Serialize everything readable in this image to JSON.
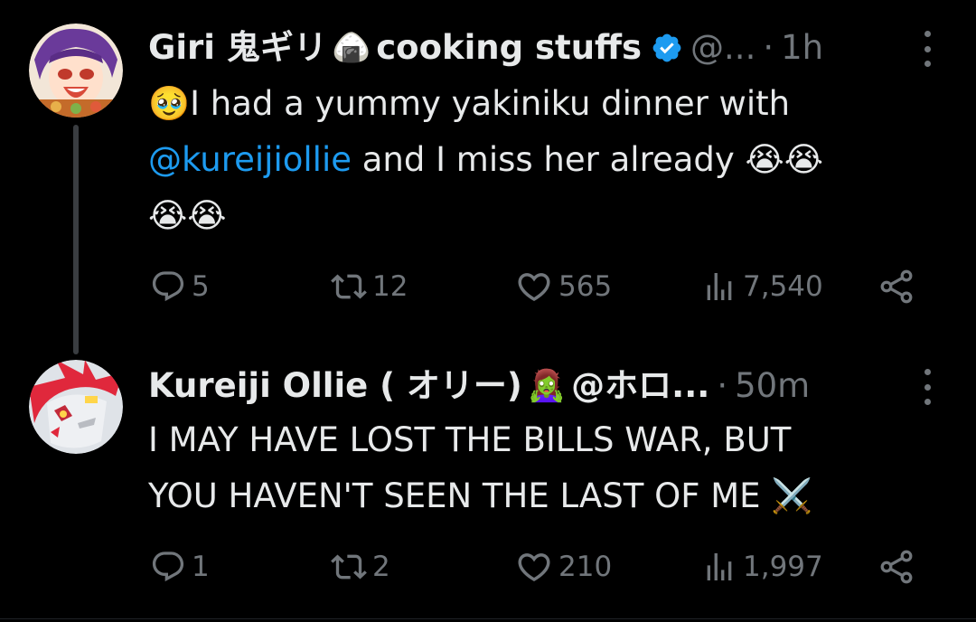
{
  "colors": {
    "background": "#000000",
    "text": "#e7e9ea",
    "muted": "#71767b",
    "mention": "#1d9bf0",
    "verified": "#1d9bf0",
    "thread_line": "#3a3d41"
  },
  "tweets": [
    {
      "avatar_icon": "avatar-giri",
      "display_name": "Giri 鬼ギリ",
      "name_emoji": "🍙",
      "display_name_suffix": "cooking stuffs",
      "verified": true,
      "handle": "@...",
      "dot": "·",
      "time": "1h",
      "body_lines": [
        {
          "emoji": "🥹",
          "text": "I had a yummy yakiniku dinner with"
        },
        {
          "mention": "@kureijiollie",
          "text": " and I miss her already 😭😭"
        },
        {
          "text": "😭😭"
        }
      ],
      "actions": {
        "reply": "5",
        "retweet": "12",
        "like": "565",
        "views": "7,540"
      }
    },
    {
      "avatar_icon": "avatar-kureiji",
      "display_name": "Kureiji Ollie ( オリー)",
      "name_emoji": "🧟‍♀️",
      "display_name_suffix": "",
      "verified": false,
      "handle": "@ホロ...",
      "dot": "·",
      "time": "50m",
      "body_lines": [
        {
          "text": "I MAY HAVE LOST THE BILLS WAR, BUT"
        },
        {
          "text": "YOU HAVEN'T SEEN THE LAST OF ME ⚔️"
        }
      ],
      "actions": {
        "reply": "1",
        "retweet": "2",
        "like": "210",
        "views": "1,997"
      }
    }
  ]
}
